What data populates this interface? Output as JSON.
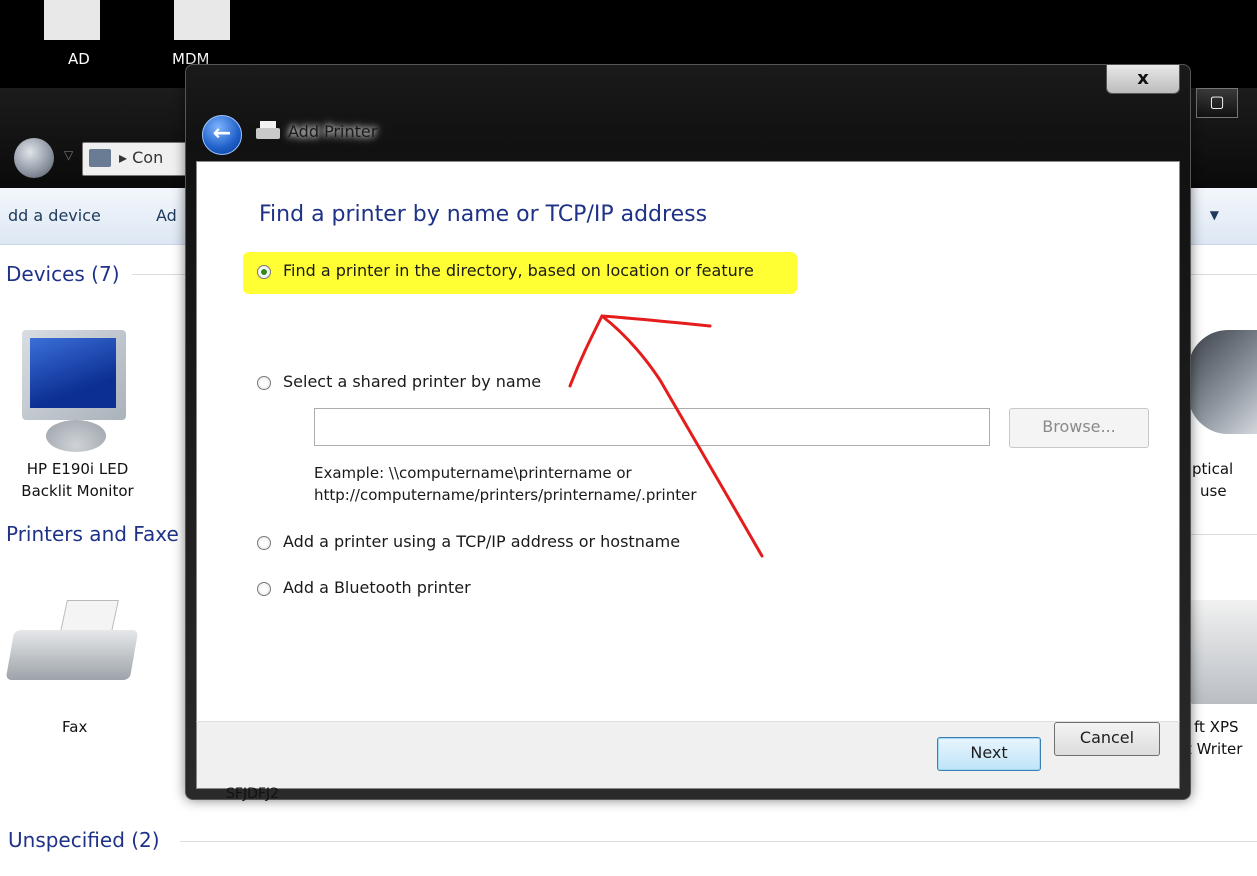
{
  "desktop": {
    "icons": [
      {
        "label": "AD"
      },
      {
        "label": "MDM"
      }
    ]
  },
  "explorer": {
    "breadcrumb_text": "Con",
    "toolbar": {
      "add_device_label": "dd a device",
      "add_printer_label": "Ad"
    },
    "groups": {
      "devices": "Devices (7)",
      "printers": "Printers and Faxe",
      "unspecified": "Unspecified (2)"
    },
    "devices": {
      "monitor_label_1": "HP E190i LED",
      "monitor_label_2": "Backlit Monitor",
      "mouse_label_1": "ptical",
      "mouse_label_2": "use",
      "fax_label": "Fax",
      "xps_label_1": "ft XPS",
      "xps_label_2": "t Writer",
      "obscured_label": "SFJDFJ2"
    }
  },
  "dialog": {
    "close_glyph": "x",
    "back_glyph": "←",
    "title": "Add Printer",
    "heading": "Find a printer by name or TCP/IP address",
    "options": {
      "directory": "Find a printer in the directory, based on location or feature",
      "shared": "Select a shared printer by name",
      "tcpip": "Add a printer using a TCP/IP address or hostname",
      "bluetooth": "Add a Bluetooth printer"
    },
    "shared_input": {
      "value": "",
      "placeholder": ""
    },
    "browse_label": "Browse...",
    "example_line_1": "Example: \\\\computername\\printername or",
    "example_line_2": "http://computername/printers/printername/.printer",
    "next_label": "Next",
    "cancel_label": "Cancel"
  },
  "colors": {
    "highlight": "#ffff33",
    "annotation_arrow": "#e51c1c",
    "heading_blue": "#1e3287",
    "radio_selected": "#2f8b1c"
  }
}
